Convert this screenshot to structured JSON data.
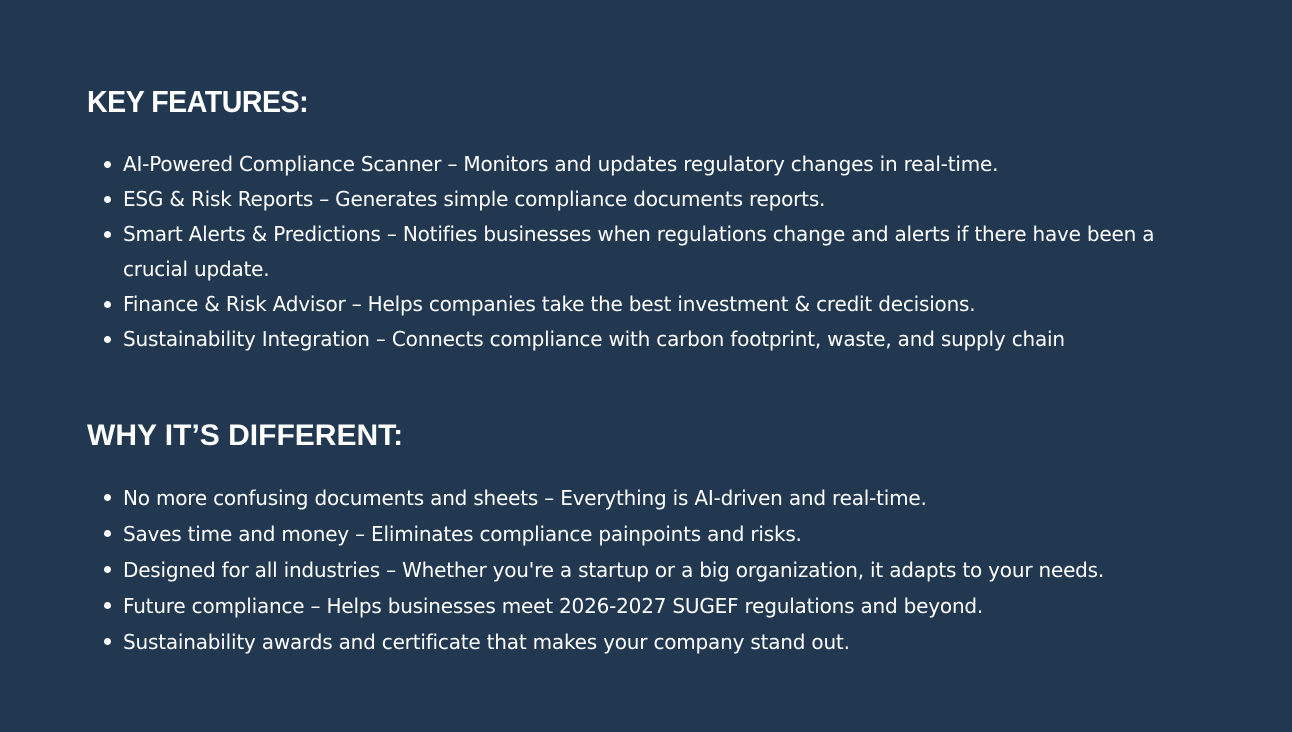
{
  "sections": {
    "key_features": {
      "title": "KEY FEATURES:",
      "items": [
        "AI-Powered Compliance Scanner – Monitors and updates regulatory changes in real-time.",
        "ESG & Risk Reports – Generates simple compliance documents reports.",
        "Smart Alerts & Predictions – Notifies businesses when regulations change and alerts if there have been a crucial update.",
        "Finance & Risk Advisor – Helps companies take the best investment & credit decisions.",
        "Sustainability Integration – Connects compliance with carbon footprint, waste, and supply chain"
      ]
    },
    "why_different": {
      "title": "WHY IT’S DIFFERENT:",
      "items": [
        "No more confusing documents and sheets – Everything is AI-driven and real-time.",
        "Saves time and money – Eliminates compliance painpoints and risks.",
        "Designed for all industries – Whether you're a startup or a big organization, it adapts to your needs.",
        "Future compliance – Helps businesses meet 2026-2027 SUGEF regulations and beyond.",
        "Sustainability awards and certificate that makes your company stand out."
      ]
    }
  },
  "colors": {
    "background": "#223850",
    "text": "#ffffff"
  }
}
